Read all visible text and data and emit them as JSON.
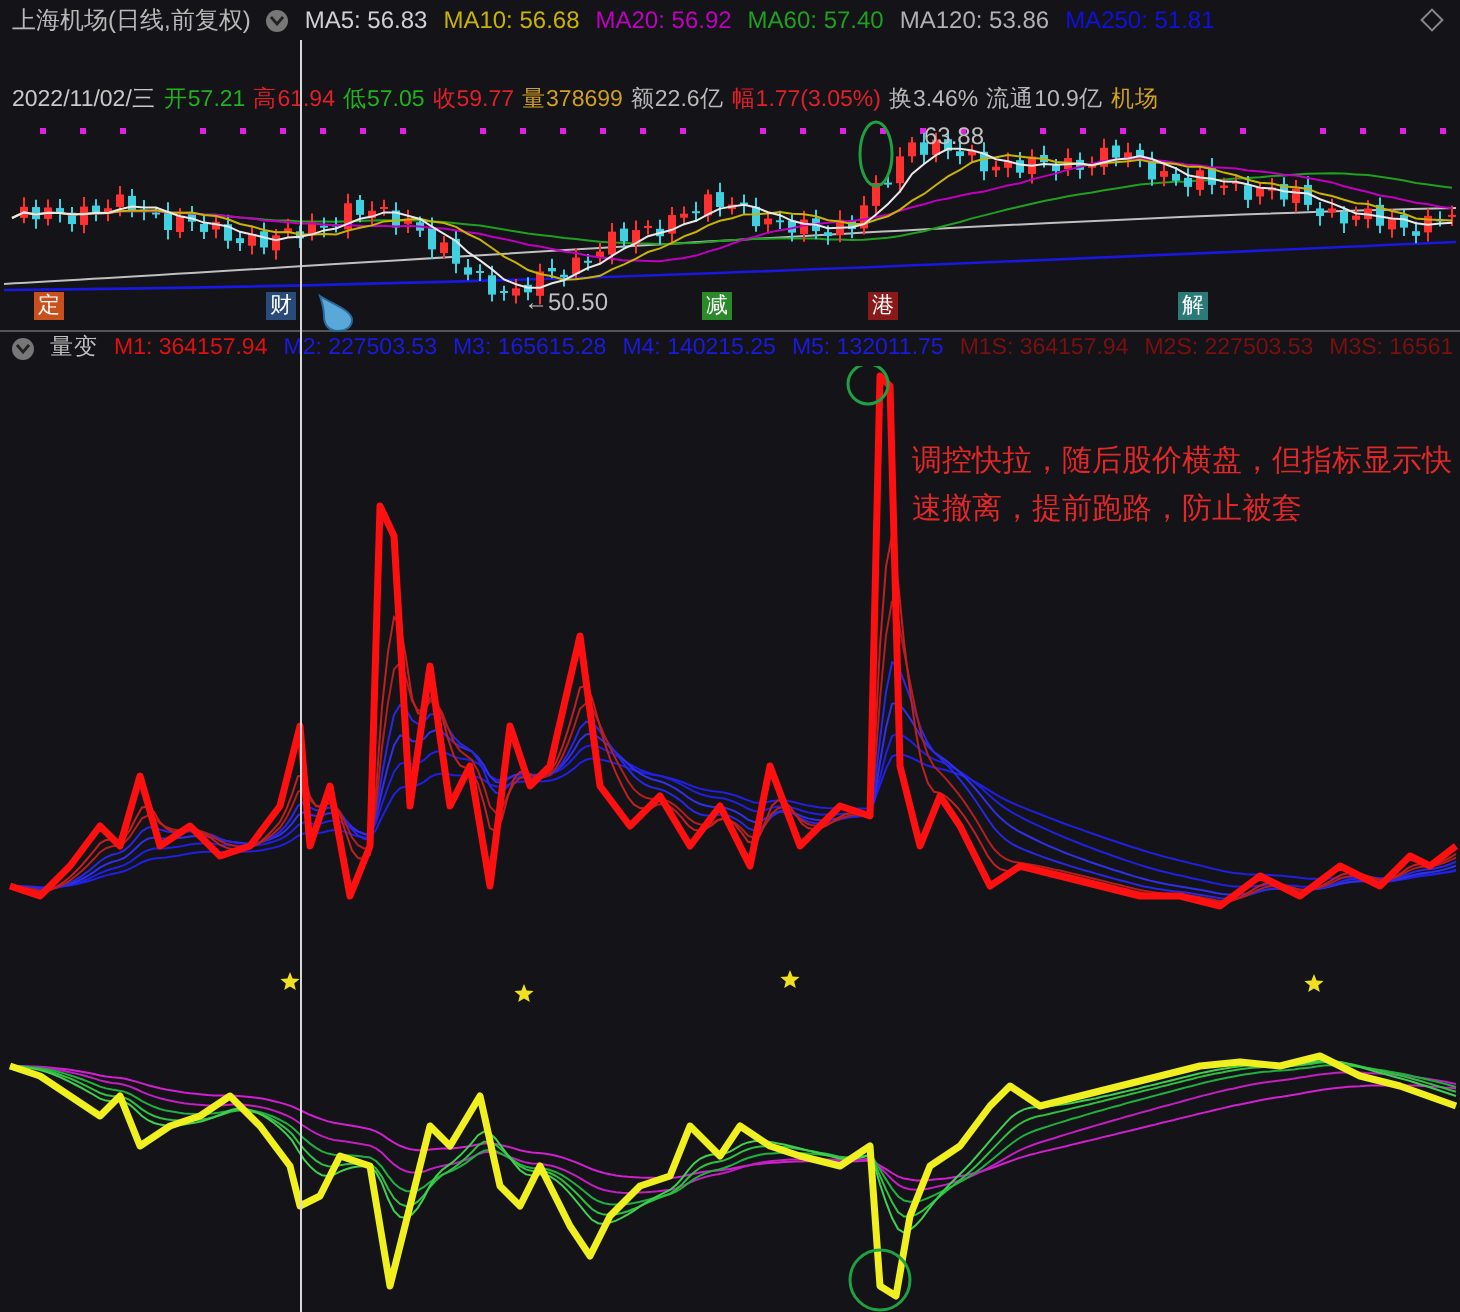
{
  "header": {
    "title": "上海机场(日线,前复权)",
    "moving_averages": [
      {
        "label": "MA5: 56.83",
        "color": "#d0d0d0"
      },
      {
        "label": "MA10: 56.68",
        "color": "#c8b400"
      },
      {
        "label": "MA20: 56.92",
        "color": "#c000c0"
      },
      {
        "label": "MA60: 57.40",
        "color": "#20a020"
      },
      {
        "label": "MA120: 53.86",
        "color": "#b0b0b0"
      },
      {
        "label": "MA250: 51.81",
        "color": "#1010e0"
      }
    ]
  },
  "quote": [
    {
      "text": "2022/11/02/三",
      "color": "#c8c8c8"
    },
    {
      "text": "开57.21",
      "color": "#20b020"
    },
    {
      "text": "高61.94",
      "color": "#e0202a"
    },
    {
      "text": "低57.05",
      "color": "#20b020"
    },
    {
      "text": "收59.77",
      "color": "#e0202a"
    },
    {
      "text": "量378699",
      "color": "#d0a020"
    },
    {
      "text": "额22.6亿",
      "color": "#b8b8b8"
    },
    {
      "text": "幅1.77(3.05%)",
      "color": "#e0202a"
    },
    {
      "text": "换3.46%",
      "color": "#b8b8b8"
    },
    {
      "text": "流通10.9亿",
      "color": "#b8b8b8"
    },
    {
      "text": "机场",
      "color": "#d0a020"
    }
  ],
  "price_chart": {
    "high_label": "63.88",
    "low_label": "←50.50"
  },
  "events": [
    {
      "label": "定",
      "color": "#c8501c"
    },
    {
      "label": "财",
      "color": "#2a4a78"
    },
    {
      "label": "减",
      "color": "#2a8a2a"
    },
    {
      "label": "港",
      "color": "#8a1a1a"
    },
    {
      "label": "解",
      "color": "#2a7a78"
    }
  ],
  "indicator": {
    "name": "量变",
    "values": [
      {
        "label": "M1: 364157.94",
        "color": "#e01010"
      },
      {
        "label": "M2: 227503.53",
        "color": "#1a1ae0"
      },
      {
        "label": "M3: 165615.28",
        "color": "#1a1ae0"
      },
      {
        "label": "M4: 140215.25",
        "color": "#1a1ae0"
      },
      {
        "label": "M5: 132011.75",
        "color": "#1a1ae0"
      },
      {
        "label": "M1S: 364157.94",
        "color": "#7a1010"
      },
      {
        "label": "M2S: 227503.53",
        "color": "#7a1010"
      },
      {
        "label": "M3S: 16561",
        "color": "#7a1010"
      }
    ],
    "note": "调控快拉，随后股价横盘，但指标显示快速撤离，提前跑路，防止被套"
  }
}
